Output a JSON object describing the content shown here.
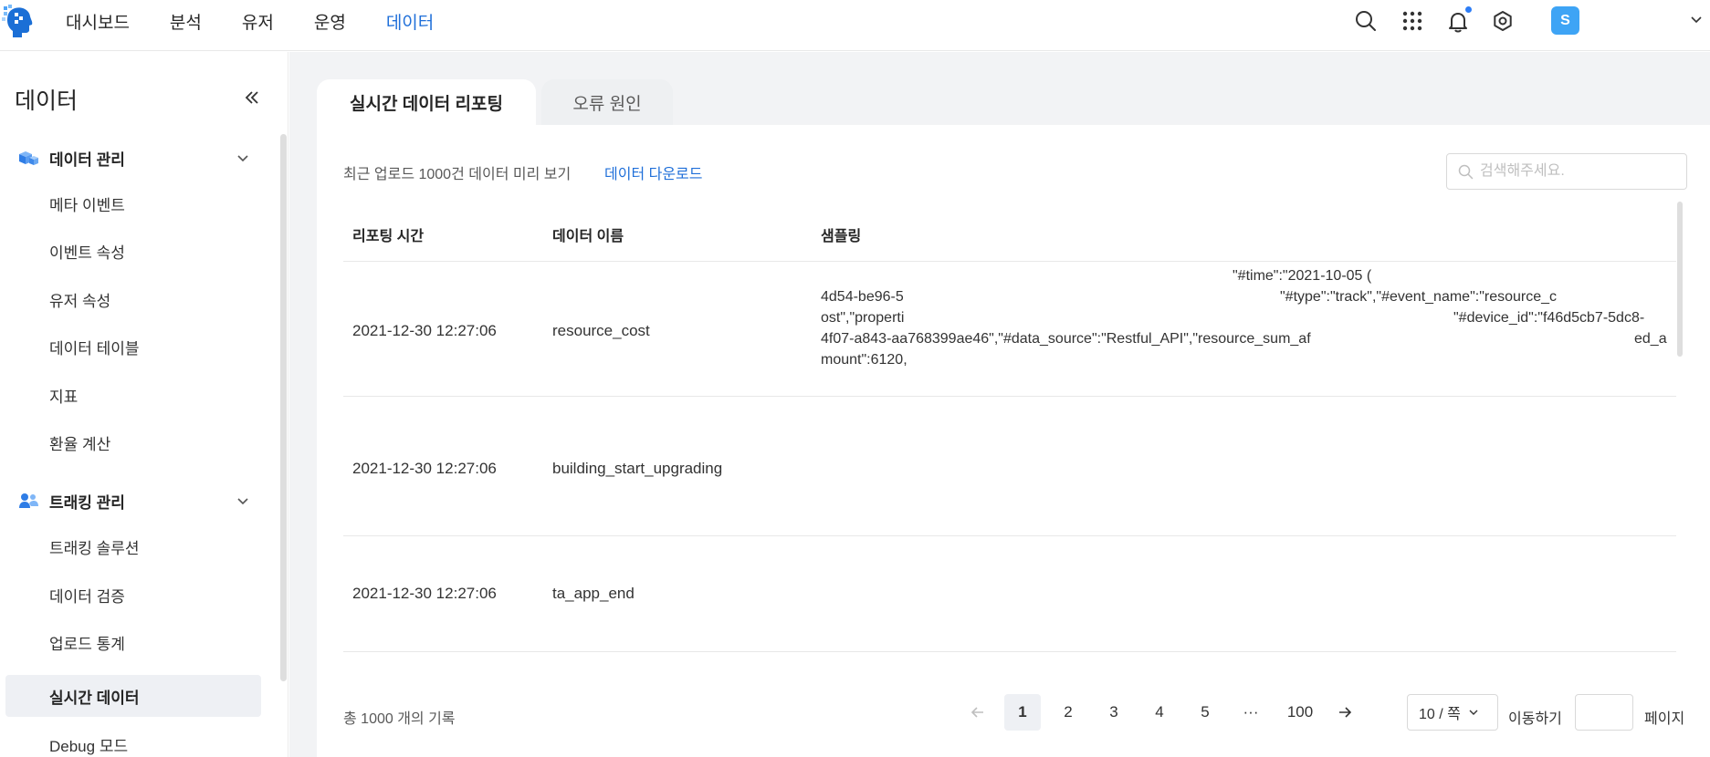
{
  "nav": {
    "items": [
      "대시보드",
      "분석",
      "유저",
      "운영",
      "데이터"
    ],
    "active_index": 4
  },
  "user": {
    "avatar_letter": "S"
  },
  "sidebar": {
    "title": "데이터",
    "groups": [
      {
        "label": "데이터 관리",
        "items": [
          "메타 이벤트",
          "이벤트 속성",
          "유저 속성",
          "데이터 테이블",
          "지표",
          "환율 계산"
        ]
      },
      {
        "label": "트래킹 관리",
        "items": [
          "트래킹 솔루션",
          "데이터 검증",
          "업로드 통계",
          "실시간 데이터",
          "Debug 모드"
        ]
      }
    ],
    "active_item": "실시간 데이터"
  },
  "tabs": [
    "실시간 데이터 리포팅",
    "오류 원인"
  ],
  "toolbar": {
    "preview_text": "최근 업로드 1000건 데이터 미리 보기",
    "download_link": "데이터 다운로드",
    "search_placeholder": "검색해주세요."
  },
  "table": {
    "headers": [
      "리포팅 시간",
      "데이터 이름",
      "샘플링"
    ],
    "rows": [
      {
        "time": "2021-12-30 12:27:06",
        "name": "resource_cost",
        "sampling": [
          "\"#time\":\"2021-10-05 (",
          "4d54-be96-5",
          "\"#type\":\"track\",\"#event_name\":\"resource_c",
          "ost\",\"properti",
          "\"#device_id\":\"f46d5cb7-5dc8-",
          "4f07-a843-aa768399ae46\",\"#data_source\":\"Restful_API\",\"resource_sum_af",
          "ed_a",
          "mount\":6120,"
        ]
      },
      {
        "time": "2021-12-30 12:27:06",
        "name": "building_start_upgrading",
        "sampling": []
      },
      {
        "time": "2021-12-30 12:27:06",
        "name": "ta_app_end",
        "sampling": []
      }
    ]
  },
  "pagination": {
    "total_text": "총 1000 개의 기록",
    "pages": [
      "1",
      "2",
      "3",
      "4",
      "5",
      "···",
      "100"
    ],
    "current": "1",
    "page_size": "10 / 쪽",
    "goto_label": "이동하기",
    "page_label": "페이지"
  },
  "colors": {
    "accent": "#1f6fd9",
    "avatar": "#3ea4f5",
    "sidebar_active_bg": "#eef0f4"
  }
}
